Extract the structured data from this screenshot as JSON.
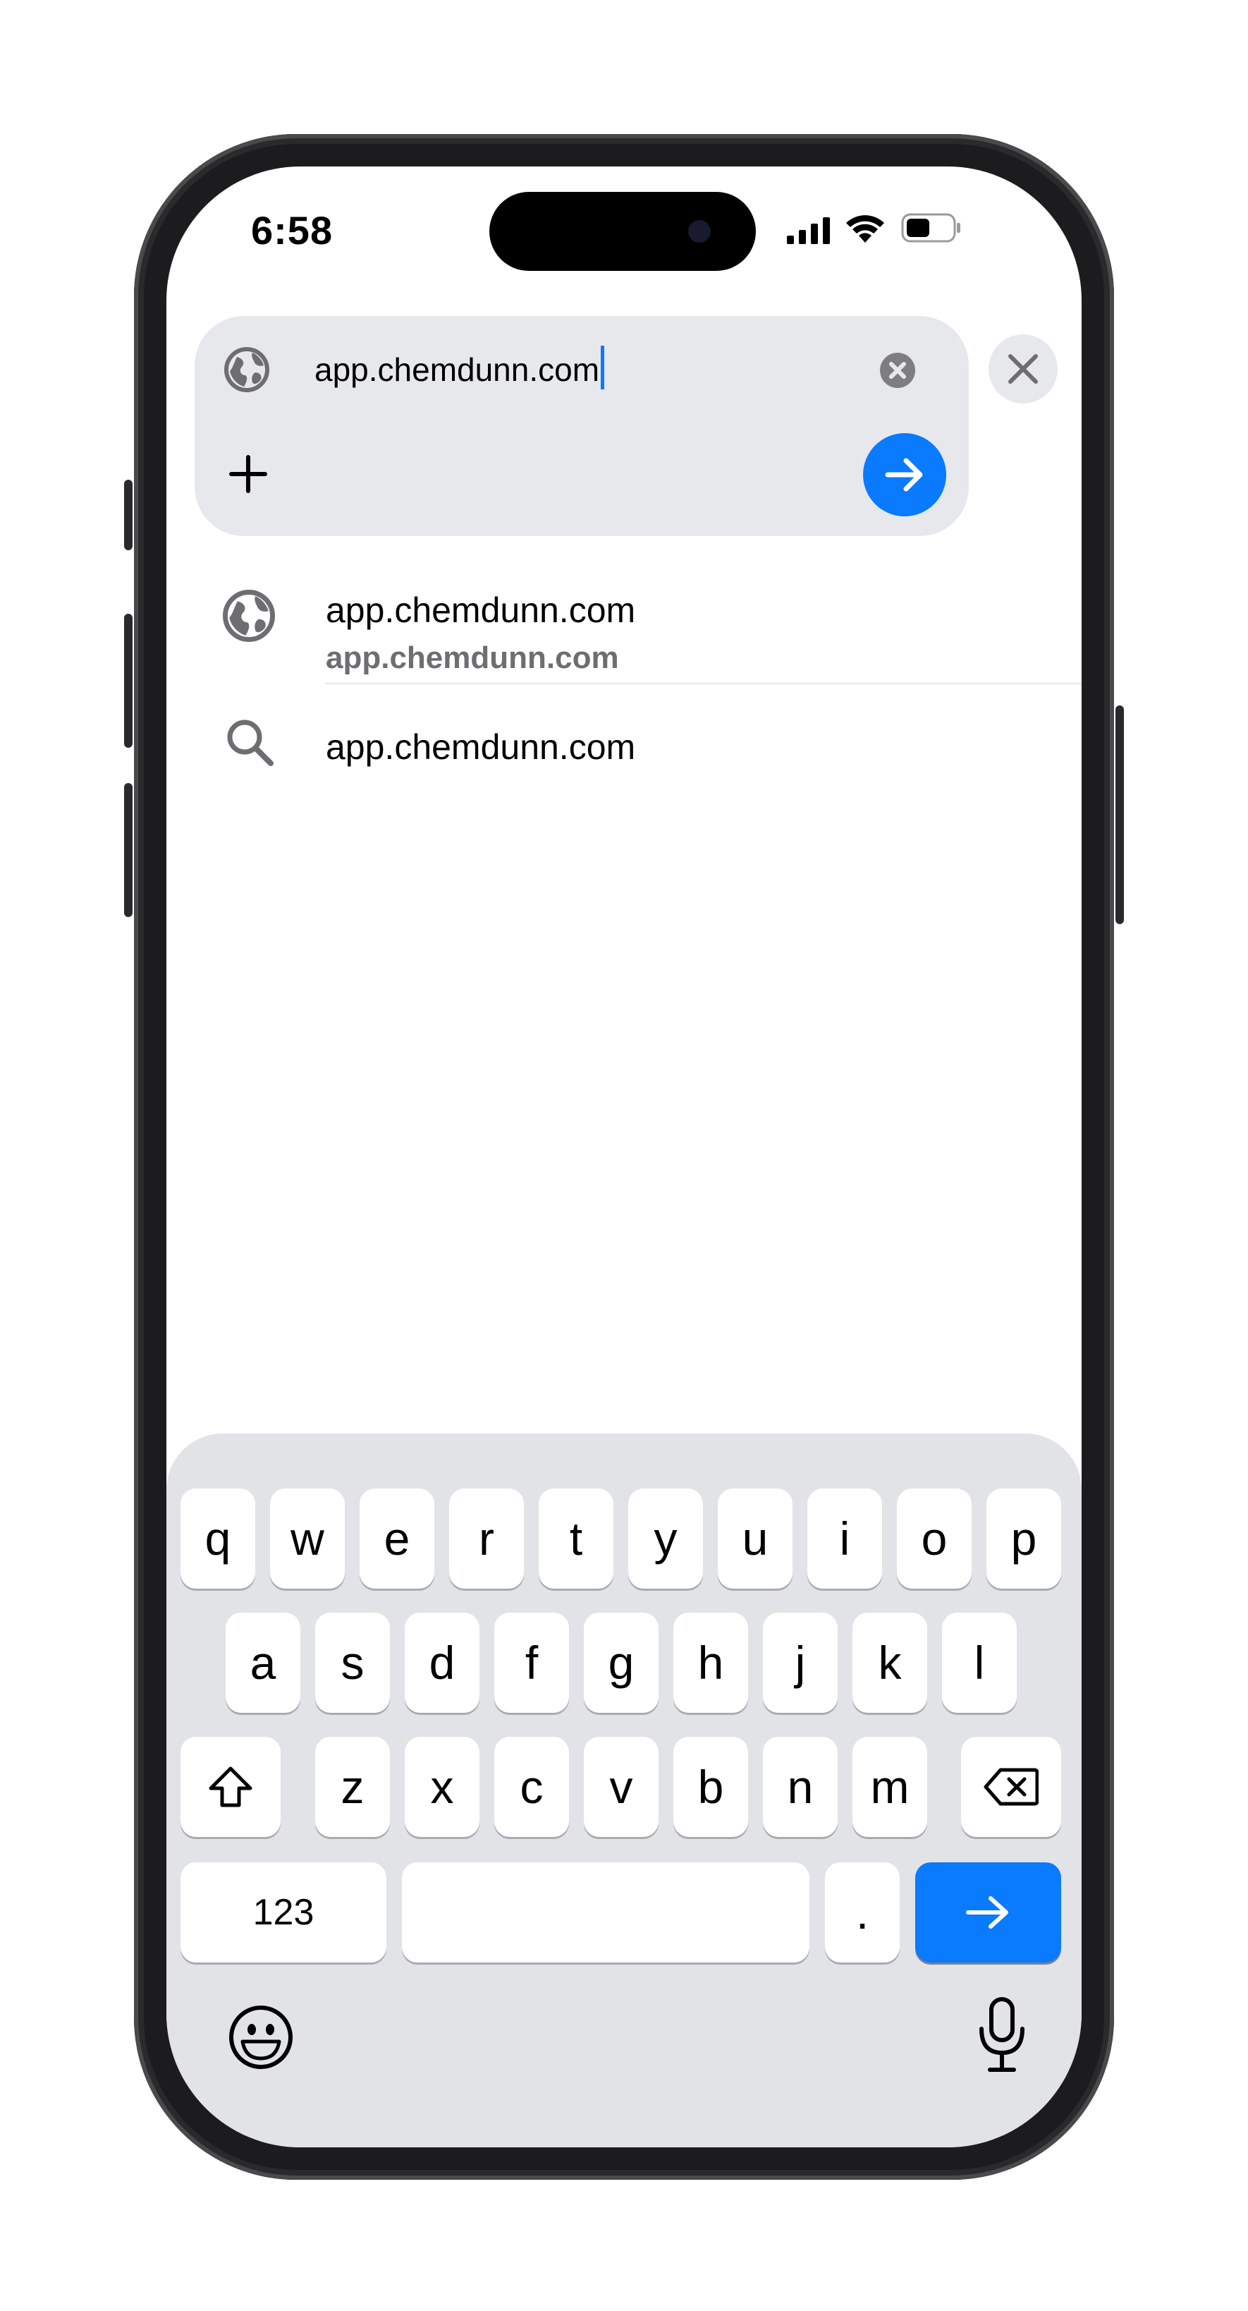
{
  "status_bar": {
    "time": "6:58",
    "icons": [
      "cellular-signal-icon",
      "wifi-icon",
      "battery-icon"
    ]
  },
  "address_bar": {
    "value": "app.chemdunn.com",
    "left_icon": "globe-icon",
    "clear_icon": "clear-circle-icon",
    "new_tab_icon": "plus-icon",
    "go_icon": "arrow-right-icon",
    "close_icon": "close-icon"
  },
  "suggestions": [
    {
      "icon": "globe-icon",
      "title": "app.chemdunn.com",
      "subtitle": "app.chemdunn.com"
    },
    {
      "icon": "search-icon",
      "title": "app.chemdunn.com"
    }
  ],
  "keyboard": {
    "row1": [
      "q",
      "w",
      "e",
      "r",
      "t",
      "y",
      "u",
      "i",
      "o",
      "p"
    ],
    "row2": [
      "a",
      "s",
      "d",
      "f",
      "g",
      "h",
      "j",
      "k",
      "l"
    ],
    "row3": [
      "z",
      "x",
      "c",
      "v",
      "b",
      "n",
      "m"
    ],
    "numbers_label": "123",
    "period_label": ".",
    "bottom_icons": [
      "emoji-icon",
      "microphone-icon"
    ]
  },
  "colors": {
    "accent": "#0a7aff",
    "panel": "#e7e8ec",
    "keyboard_bg": "#e2e3e7"
  }
}
